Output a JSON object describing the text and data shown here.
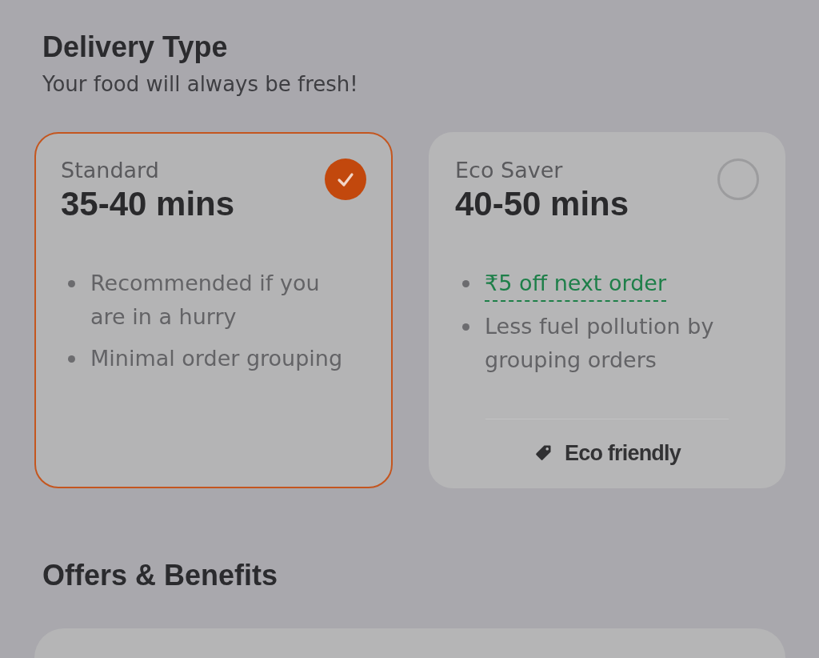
{
  "delivery_section": {
    "title": "Delivery Type",
    "subtitle": "Your food will always be fresh!"
  },
  "delivery_options": [
    {
      "name": "Standard",
      "time": "35-40 mins",
      "selected": true,
      "benefits": [
        {
          "kind": "plain",
          "text": "Recommended if you are in a hurry"
        },
        {
          "kind": "plain",
          "text": "Minimal order grouping"
        }
      ]
    },
    {
      "name": "Eco Saver",
      "time": "40-50 mins",
      "selected": false,
      "benefits": [
        {
          "kind": "offer",
          "text": "₹5 off next order"
        },
        {
          "kind": "plain",
          "text": "Less fuel pollution by grouping orders"
        }
      ],
      "footer_tag": "Eco friendly"
    }
  ],
  "offers_section": {
    "title": "Offers & Benefits"
  }
}
